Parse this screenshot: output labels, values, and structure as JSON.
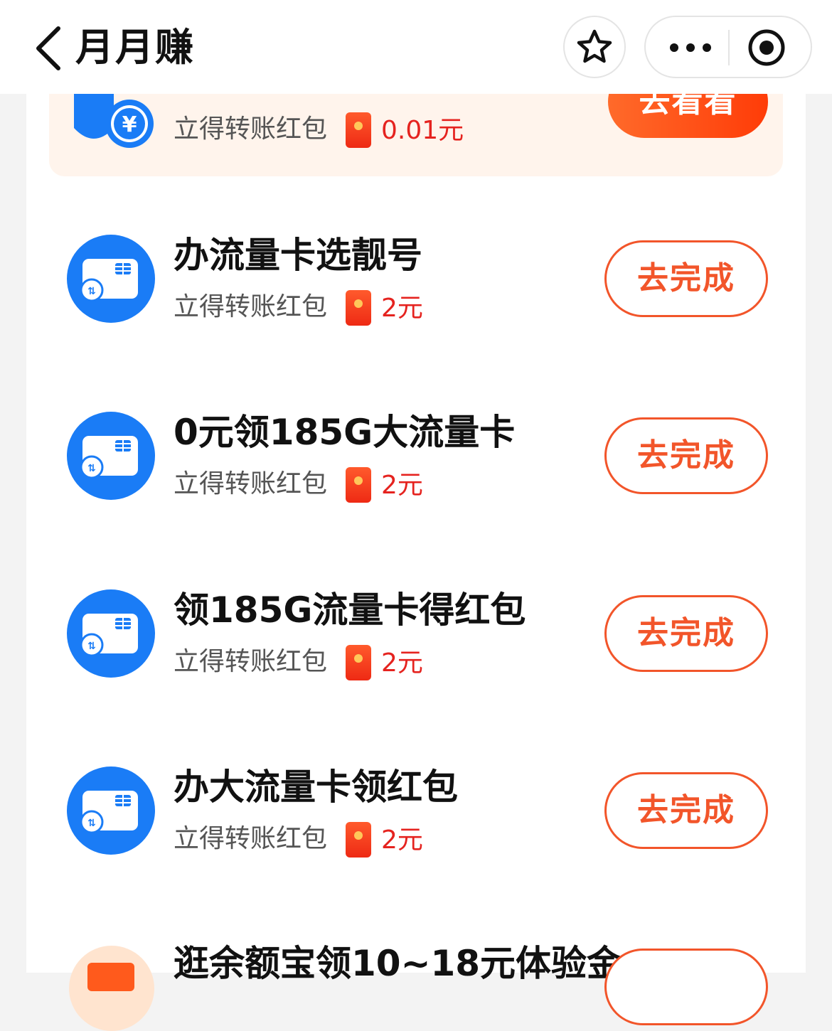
{
  "nav": {
    "title": "月月赚"
  },
  "top_task": {
    "subtitle": "立得转账红包",
    "reward": "0.01元",
    "button": "去看看"
  },
  "tasks": [
    {
      "title": "办流量卡选靓号",
      "subtitle": "立得转账红包",
      "reward": "2元",
      "button": "去完成"
    },
    {
      "title": "0元领185G大流量卡",
      "subtitle": "立得转账红包",
      "reward": "2元",
      "button": "去完成"
    },
    {
      "title": "领185G流量卡得红包",
      "subtitle": "立得转账红包",
      "reward": "2元",
      "button": "去完成"
    },
    {
      "title": "办大流量卡领红包",
      "subtitle": "立得转账红包",
      "reward": "2元",
      "button": "去完成"
    }
  ],
  "partial_task": {
    "title": "逛余额宝领10~18元体验金"
  },
  "colors": {
    "accent": "#f2552a",
    "reward_red": "#e5231f",
    "icon_blue": "#1a7cf6",
    "top_task_bg": "#fff4ec"
  }
}
